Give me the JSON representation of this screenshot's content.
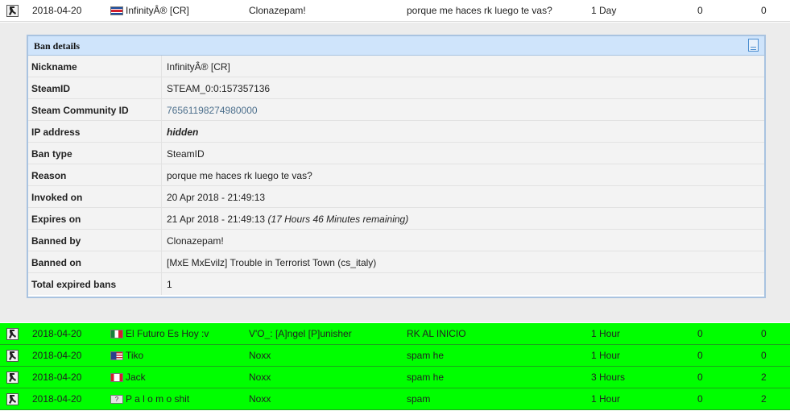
{
  "top_row": {
    "date": "2018-04-20",
    "name": "InfinityÂ® [CR]",
    "admin": "Clonazepam!",
    "reason": "porque me haces rk luego te vas?",
    "length": "1 Day",
    "count1": "0",
    "count2": "0",
    "flag_colors": [
      "#1d4fa0",
      "#ffffff",
      "#d21f2e"
    ]
  },
  "ban_details": {
    "title": "Ban details",
    "rows": [
      {
        "label": "Nickname",
        "value": "InfinityÂ® [CR]"
      },
      {
        "label": "SteamID",
        "value": "STEAM_0:0:157357136"
      },
      {
        "label": "Steam Community ID",
        "value": "76561198274980000"
      },
      {
        "label": "IP address",
        "value": "hidden"
      },
      {
        "label": "Ban type",
        "value": "SteamID"
      },
      {
        "label": "Reason",
        "value": "porque me haces rk luego te vas?"
      },
      {
        "label": "Invoked on",
        "value": "20 Apr 2018 - 21:49:13"
      },
      {
        "label": "Expires on",
        "value": "21 Apr 2018 - 21:49:13",
        "extra": "(17 Hours 46 Minutes remaining)"
      },
      {
        "label": "Banned by",
        "value": "Clonazepam!"
      },
      {
        "label": "Banned on",
        "value": "[MxE MxEvilz] Trouble in Terrorist Town (cs_italy)"
      },
      {
        "label": "Total expired bans",
        "value": "1"
      }
    ]
  },
  "ban_rows": [
    {
      "date": "2018-04-20",
      "name": "El Futuro Es Hoy :v",
      "admin": "V'O_: [A]ngel [P]unisher",
      "reason": "RK AL INICIO",
      "length": "1 Hour",
      "count1": "0",
      "count2": "0",
      "flag": "mexico-flag-icon"
    },
    {
      "date": "2018-04-20",
      "name": "Tiko",
      "admin": "Noxx",
      "reason": "spam he",
      "length": "1 Hour",
      "count1": "0",
      "count2": "0",
      "flag": "usa-flag-icon"
    },
    {
      "date": "2018-04-20",
      "name": "Jack",
      "admin": "Noxx",
      "reason": "spam he",
      "length": "3 Hours",
      "count1": "0",
      "count2": "2",
      "flag": "canada-flag-icon"
    },
    {
      "date": "2018-04-20",
      "name": "P a l o m o shit",
      "admin": "Noxx",
      "reason": "spam",
      "length": "1 Hour",
      "count1": "0",
      "count2": "2",
      "flag": "unknown-flag-icon"
    }
  ],
  "colors": {
    "active_row": "#00ff00",
    "panel_header": "#cfe4fb",
    "panel_border": "#a9c3e0",
    "link": "#4c6f8c"
  }
}
